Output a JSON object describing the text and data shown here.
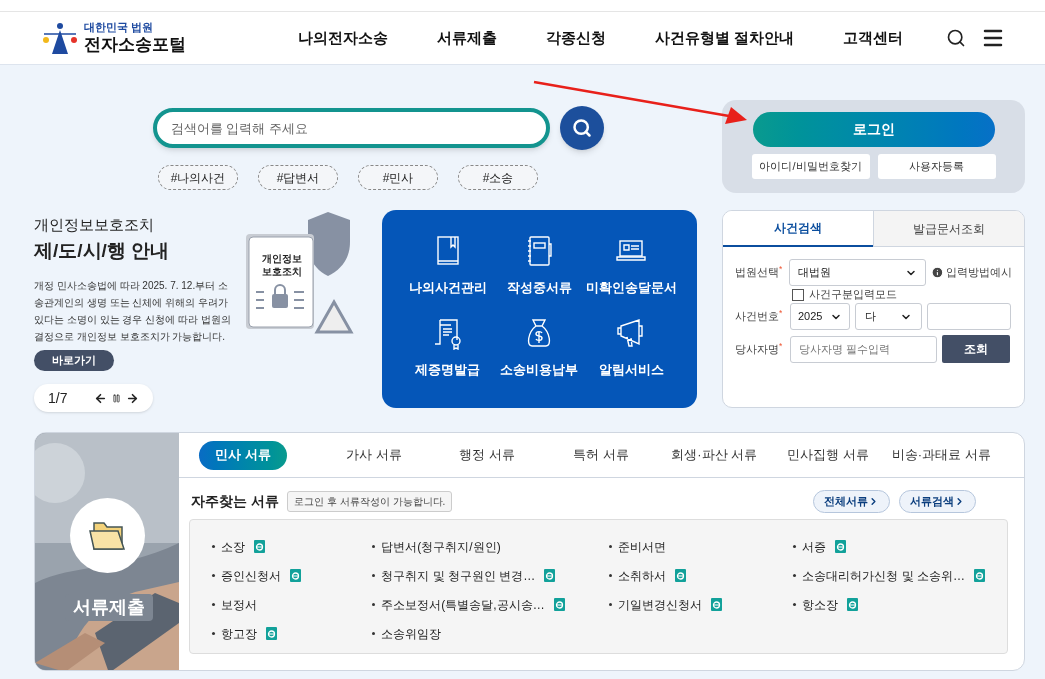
{
  "logo": {
    "small": "대한민국 법원",
    "large": "전자소송포털"
  },
  "nav": [
    "나의전자소송",
    "서류제출",
    "각종신청",
    "사건유형별 절차안내",
    "고객센터"
  ],
  "search": {
    "placeholder": "검색어를 입력해 주세요"
  },
  "tags": [
    "#나의사건",
    "#답변서",
    "#민사",
    "#소송"
  ],
  "promo": {
    "subtitle": "개인정보보호조치",
    "title": "제/도/시/행 안내",
    "body": "개정 민사소송법에 따라 2025. 7. 12.부터 소송관계인의 생명 또는 신체에 위해의 우려가 있다는 소명이 있는 경우 신청에 따라 법원의 결정으로 개인정보 보호조치가 가능합니다.",
    "button": "바로가기",
    "doc_label": "개인정보\n보호조치",
    "pager": "1/7"
  },
  "quick": [
    {
      "label": "나의사건관리",
      "kind": "book"
    },
    {
      "label": "작성중서류",
      "kind": "notebook"
    },
    {
      "label": "미확인송달문서",
      "kind": "laptop"
    },
    {
      "label": "제증명발급",
      "kind": "certificate"
    },
    {
      "label": "소송비용납부",
      "kind": "moneybag"
    },
    {
      "label": "알림서비스",
      "kind": "megaphone"
    }
  ],
  "login": {
    "button": "로그인",
    "links": [
      "아이디/비밀번호찾기",
      "사용자등록"
    ]
  },
  "case_search": {
    "tabs": [
      {
        "label": "사건검색",
        "selected": true
      },
      {
        "label": "발급문서조회",
        "selected": false
      }
    ],
    "required_mark": "*",
    "court_label": "법원선택",
    "court": "대법원",
    "help": "입력방법예시",
    "mode_label": "사건구분입력모드",
    "mode_checked": false,
    "number_label": "사건번호",
    "year": "2025",
    "type": "다",
    "party_label": "당사자명",
    "party_placeholder": "당사자명 필수입력",
    "submit": "조회"
  },
  "docs": {
    "image_label": "서류제출",
    "tabs": [
      {
        "label": "민사 서류",
        "selected": true
      },
      {
        "label": "가사 서류",
        "selected": false
      },
      {
        "label": "행정 서류",
        "selected": false
      },
      {
        "label": "특허 서류",
        "selected": false
      },
      {
        "label": "회생·파산 서류",
        "selected": false
      },
      {
        "label": "민사집행 서류",
        "selected": false
      },
      {
        "label": "비송·과태료 서류",
        "selected": false
      }
    ],
    "heading": "자주찾는 서류",
    "notice": "로그인 후 서류작성이 가능합니다.",
    "buttons": [
      "전체서류",
      "서류검색"
    ],
    "items": [
      {
        "label": "소장",
        "ebook": true
      },
      {
        "label": "답변서(청구취지/원인)",
        "ebook": false
      },
      {
        "label": "준비서면",
        "ebook": false
      },
      {
        "label": "서증",
        "ebook": true
      },
      {
        "label": "증인신청서",
        "ebook": true
      },
      {
        "label": "청구취지 및 청구원인 변경…",
        "ebook": true
      },
      {
        "label": "소취하서",
        "ebook": true
      },
      {
        "label": "소송대리허가신청 및 소송위…",
        "ebook": true
      },
      {
        "label": "보정서",
        "ebook": false
      },
      {
        "label": "주소보정서(특별송달,공시송…",
        "ebook": true
      },
      {
        "label": "기일변경신청서",
        "ebook": true
      },
      {
        "label": "항소장",
        "ebook": true
      },
      {
        "label": "항고장",
        "ebook": true
      },
      {
        "label": "소송위임장",
        "ebook": false
      }
    ]
  }
}
